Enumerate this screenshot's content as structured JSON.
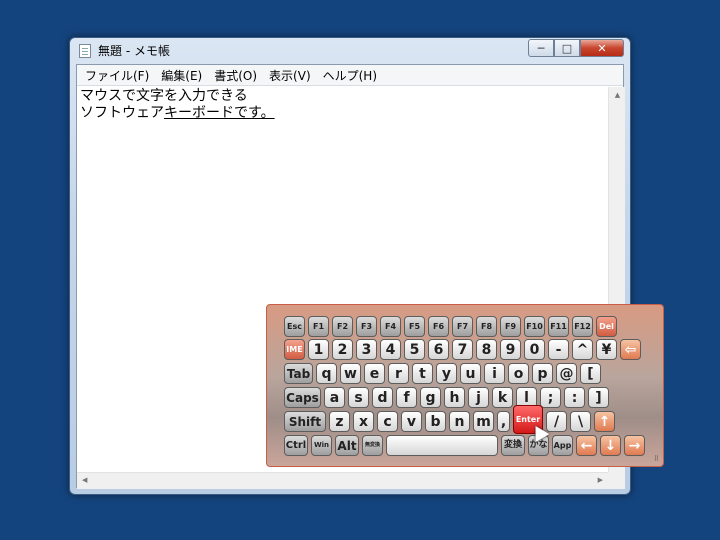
{
  "window": {
    "title": "無題 - メモ帳",
    "controls": {
      "minimize": "─",
      "maximize": "□",
      "close": "✕"
    }
  },
  "menubar": {
    "items": [
      "ファイル(F)",
      "編集(E)",
      "書式(O)",
      "表示(V)",
      "ヘルプ(H)"
    ]
  },
  "editor": {
    "line1": "マウスで文字を入力できる",
    "line2_prefix": "ソフトウェア",
    "line2_underlined": "キーボードです。"
  },
  "keyboard": {
    "row1": [
      "Esc",
      "F1",
      "F2",
      "F3",
      "F4",
      "F5",
      "F6",
      "F7",
      "F8",
      "F9",
      "F10",
      "F11",
      "F12",
      "Del"
    ],
    "row2": [
      "IME",
      "1",
      "2",
      "3",
      "4",
      "5",
      "6",
      "7",
      "8",
      "9",
      "0",
      "-",
      "^",
      "¥",
      "⇦"
    ],
    "row3": [
      "Tab",
      "q",
      "w",
      "e",
      "r",
      "t",
      "y",
      "u",
      "i",
      "o",
      "p",
      "@",
      "["
    ],
    "row4": [
      "Caps",
      "a",
      "s",
      "d",
      "f",
      "g",
      "h",
      "j",
      "k",
      "l",
      ";",
      ":",
      "]"
    ],
    "row5": [
      "Shift",
      "z",
      "x",
      "c",
      "v",
      "b",
      "n",
      "m",
      ",",
      "Enter",
      "/",
      "\\",
      "↑"
    ],
    "row6": [
      "Ctrl",
      "Win",
      "Alt",
      "無変換",
      "",
      "変換",
      "かな",
      "App",
      "←",
      "↓",
      "→"
    ]
  },
  "colors": {
    "desktop": "#14447e",
    "keyboard_accent": "#d25c42",
    "enter_key": "#d41818"
  }
}
